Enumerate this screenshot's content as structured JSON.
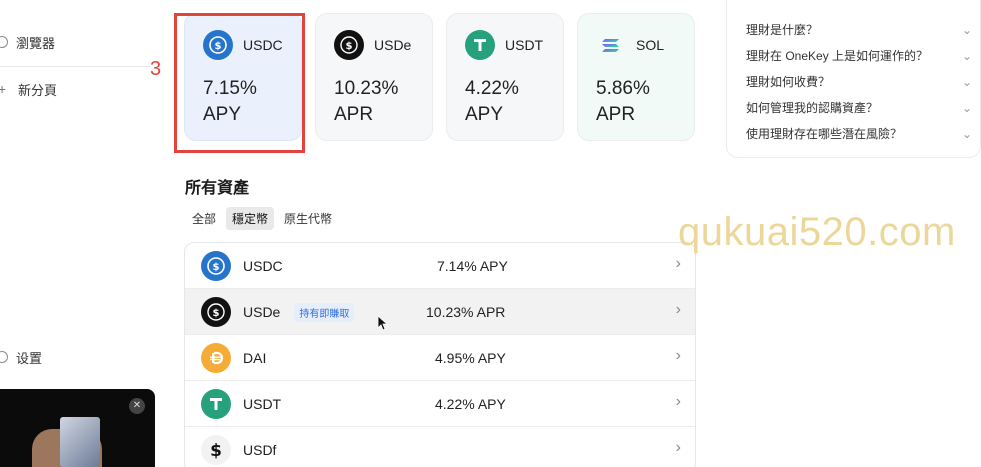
{
  "sidebar": {
    "items": [
      {
        "label": "瀏覽器"
      },
      {
        "label": "新分頁"
      },
      {
        "label": "设置"
      }
    ]
  },
  "annotation": {
    "number": "3"
  },
  "featured": [
    {
      "symbol": "USDC",
      "rate": "7.15%",
      "type": "APY"
    },
    {
      "symbol": "USDe",
      "rate": "10.23%",
      "type": "APR"
    },
    {
      "symbol": "USDT",
      "rate": "4.22%",
      "type": "APY"
    },
    {
      "symbol": "SOL",
      "rate": "5.86%",
      "type": "APR"
    }
  ],
  "assets_section": {
    "title": "所有資產",
    "filters": [
      {
        "label": "全部"
      },
      {
        "label": "穩定幣"
      },
      {
        "label": "原生代幣"
      }
    ],
    "active_filter": "穩定幣",
    "rows": [
      {
        "symbol": "USDC",
        "rate": "7.14% APY",
        "badge": ""
      },
      {
        "symbol": "USDe",
        "rate": "10.23% APR",
        "badge": "持有即賺取"
      },
      {
        "symbol": "DAI",
        "rate": "4.95% APY",
        "badge": ""
      },
      {
        "symbol": "USDT",
        "rate": "4.22% APY",
        "badge": ""
      },
      {
        "symbol": "USDf",
        "rate": "",
        "badge": ""
      }
    ]
  },
  "faq": {
    "items": [
      {
        "question": "理財是什麼？"
      },
      {
        "question": "理財在 OneKey 上是如何運作的？"
      },
      {
        "question": "理財如何收費？"
      },
      {
        "question": "如何管理我的認購資產？"
      },
      {
        "question": "使用理財存在哪些潛在風險？"
      }
    ]
  },
  "watermark": "qukuai520.com",
  "colors": {
    "usdc": "#2775ca",
    "usde": "#111111",
    "usdt": "#26a17b",
    "dai": "#f5ac37",
    "annotation": "#e0443c",
    "badge": "#2f6de0"
  },
  "icons": {
    "usdc": "usdc-coin-icon",
    "usde": "usde-coin-icon",
    "usdt": "usdt-coin-icon",
    "sol": "sol-coin-icon",
    "dai": "dai-coin-icon",
    "usdf": "usdf-coin-icon",
    "chevron": "chevron-right-icon"
  }
}
